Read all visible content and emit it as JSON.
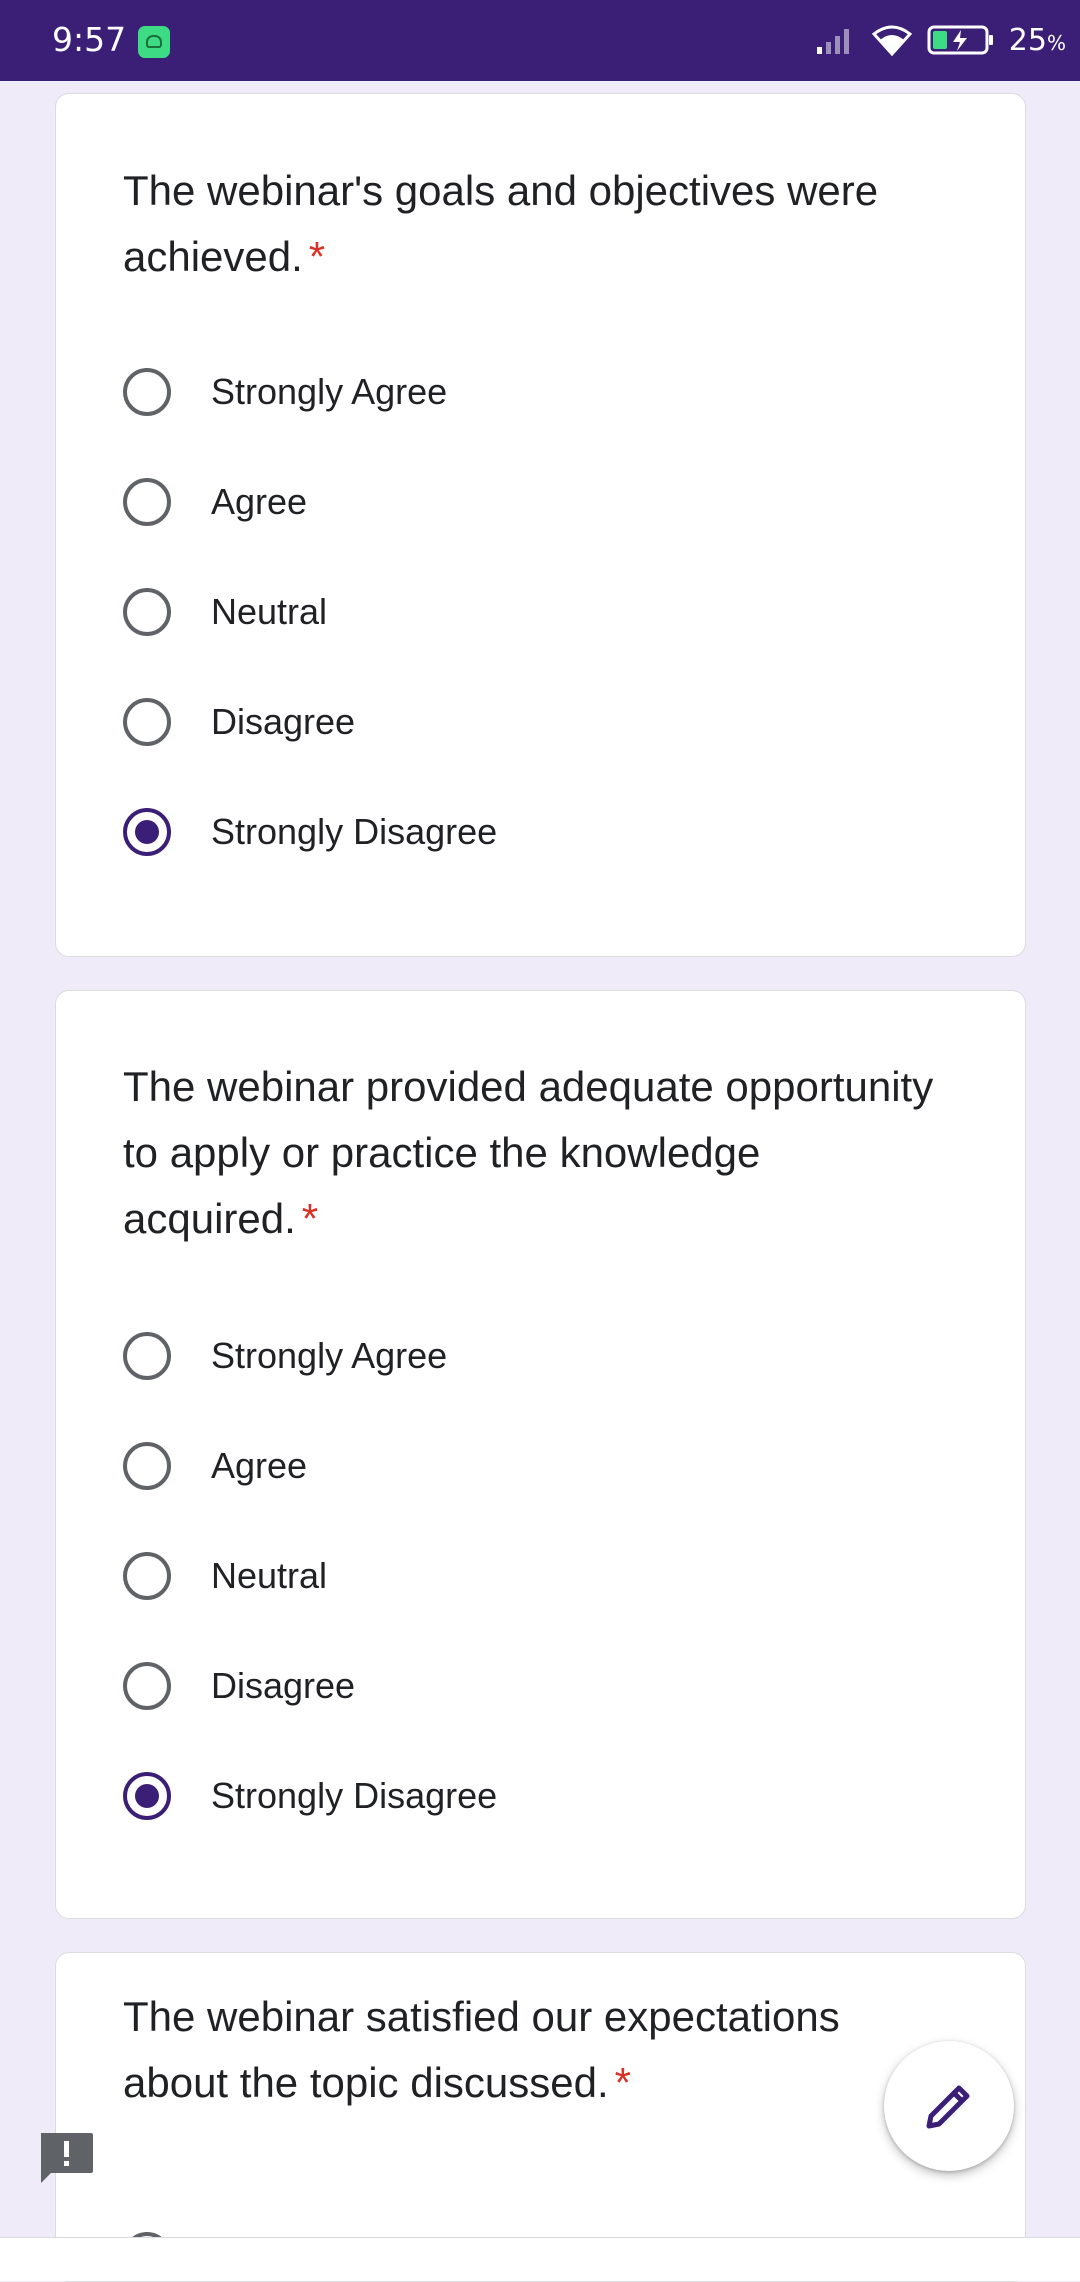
{
  "status_bar": {
    "time": "9:57",
    "battery_percent": "25",
    "battery_unit": "%"
  },
  "colors": {
    "accent": "#3b1f77",
    "background": "#f0ebf8",
    "required": "#d93025"
  },
  "questions": [
    {
      "title": "The webinar's goals and objectives were achieved.",
      "required_mark": "*",
      "options": [
        "Strongly Agree",
        "Agree",
        "Neutral",
        "Disagree",
        "Strongly Disagree"
      ],
      "selected": "Strongly Disagree"
    },
    {
      "title": "The webinar provided adequate opportunity to apply or practice the knowledge acquired.",
      "required_mark": "*",
      "options": [
        "Strongly Agree",
        "Agree",
        "Neutral",
        "Disagree",
        "Strongly Disagree"
      ],
      "selected": "Strongly Disagree"
    },
    {
      "title": "The webinar satisfied our expectations about the topic discussed.",
      "required_mark": "*",
      "options": [],
      "selected": null
    }
  ],
  "icons": {
    "fab": "pencil-icon",
    "report": "report-icon"
  }
}
